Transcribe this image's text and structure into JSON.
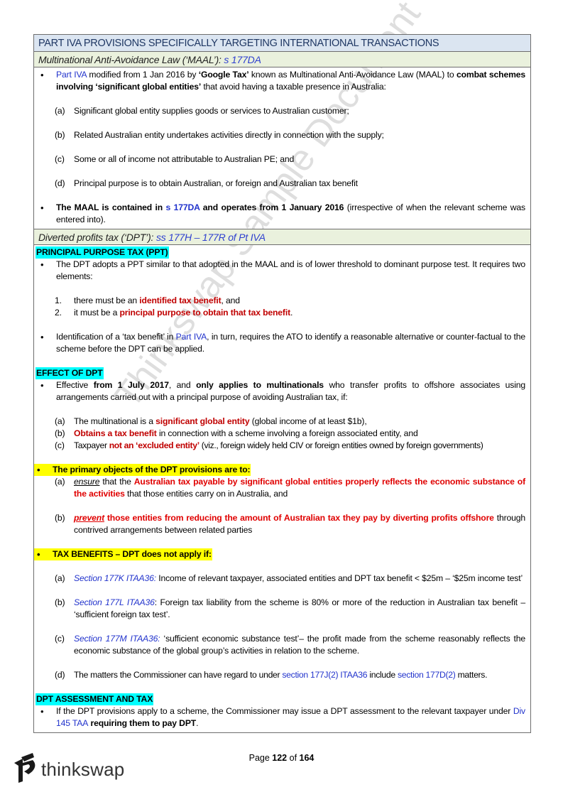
{
  "doc": {
    "title": "PART IVA PROVISIONS SPECIFICALLY TARGETING INTERNATIONAL TRANSACTIONS",
    "maal": {
      "heading_text": "Multinational Anti-Avoidance Law (‘MAAL’): ",
      "heading_ref": "s 177DA",
      "bullet1": {
        "link": "Part IVA",
        "t1": " modified from 1 Jan 2016 by ",
        "b1": "‘Google Tax’",
        "t2": " known as Multinational Anti-Avoidance Law (MAAL) to ",
        "b2": "combat schemes involving ‘significant global entities’",
        "t3": " that avoid having a taxable presence in Australia:"
      },
      "items": [
        {
          "label": "(a)",
          "text": "Significant global entity supplies goods or services to Australian customer;"
        },
        {
          "label": "(b)",
          "text": "Related Australian entity undertakes activities directly in connection with the supply;"
        },
        {
          "label": "(c)",
          "text": "Some or all of income not attributable to Australian PE; and"
        },
        {
          "label": "(d)",
          "text": "Principal purpose is to obtain Australian, or foreign and Australian tax benefit"
        }
      ],
      "bullet2": {
        "b1": "The MAAL is contained in ",
        "link": "s 177DA",
        "b2": " and operates from 1 January 2016",
        "t1": " (irrespective of when the relevant scheme was entered into)."
      }
    },
    "dpt": {
      "heading_text": "Diverted profits tax (‘DPT’): ",
      "heading_ref": "ss 177H – 177R of Pt IVA",
      "ppt": {
        "label": "PRINCIPAL PURPOSE TAX (PPT)",
        "bullet1": "The DPT adopts a PPT similar to that adopted in the MAAL and is of lower threshold to dominant purpose test. It requires two elements:",
        "items": [
          {
            "label": "1.",
            "t1": "there must be an ",
            "red": "identified tax benefit",
            "t2": ", and"
          },
          {
            "label": "2.",
            "t1": "it must be a ",
            "red": "principal purpose to obtain that tax benefit",
            "t2": "."
          }
        ],
        "bullet2": {
          "t1": "Identification of a ‘tax benefit’ in ",
          "link": "Part IVA",
          "t2": ", in turn, requires the ATO to identify a reasonable alternative or counter-factual to the scheme before the DPT can be applied."
        }
      },
      "effect": {
        "label": "EFFECT OF DPT",
        "bullet1": {
          "t1": "Effective ",
          "b1": "from 1 July 2017",
          "t2": ", and ",
          "b2": "only applies to multinationals",
          "t3": " who transfer profits to offshore associates using arrangements carried out with a principal purpose of avoiding Australian tax, if:"
        },
        "items": [
          {
            "label": "(a)",
            "t1": "The multinational is a ",
            "red": "significant global entity",
            "t2": " (global income of at least $1b),"
          },
          {
            "label": "(b)",
            "t1": "",
            "red": "Obtains a tax benefit",
            "t2": " in connection with a scheme involving a foreign associated entity, and"
          },
          {
            "label": "(c)",
            "t1": "Taxpayer ",
            "red": "not an ‘excluded entity’",
            "t2": " (viz., foreign widely held CIV or foreign entities owned by foreign governments)"
          }
        ],
        "objects": {
          "heading": "The primary objects of the DPT provisions are to:",
          "items": [
            {
              "label": "(a)",
              "em": "ensure",
              "t1": " that the ",
              "red": "Australian tax payable by significant global entities properly reflects the economic substance of the activities",
              "t2": " that those entities carry on in Australia, and"
            },
            {
              "label": "(b)",
              "em": "prevent",
              "t1": " ",
              "red": "those entities from reducing the amount of Australian tax they pay by diverting profits offshore",
              "t2": " through contrived arrangements between related parties"
            }
          ]
        },
        "benefits": {
          "heading": "TAX BENEFITS – DPT does not apply if:",
          "items": [
            {
              "label": "(a)",
              "ref": "Section 177K ITAA36:",
              "text": " Income of relevant taxpayer, associated entities and DPT tax benefit < $25m – ‘$25m income test’"
            },
            {
              "label": "(b)",
              "ref": "Section 177L ITAA36",
              "text": ": Foreign tax liability from the scheme is 80% or more of the reduction in Australian tax benefit – ‘sufficient foreign tax test’."
            },
            {
              "label": "(c)",
              "ref": "Section 177M ITAA36:",
              "text": " ‘sufficient economic substance test’– the profit made from the scheme reasonably reflects the economic substance of the global group’s activities in relation to the scheme."
            }
          ],
          "item_d": {
            "label": "(d)",
            "t1": "The matters the Commissioner can have regard to under ",
            "link1": "section 177J(2) ITAA36",
            "t2": " include ",
            "link2": "section 177D(2)",
            "t3": " matters."
          }
        }
      },
      "assessment": {
        "label": "DPT ASSESSMENT AND TAX",
        "t1": "If the DPT provisions apply to a scheme, the Commissioner may issue a DPT assessment to the relevant taxpayer under ",
        "link": "Div 145 TAA",
        "b1": " requiring them to pay DPT",
        "t2": "."
      }
    }
  },
  "footer": {
    "page_prefix": "Page ",
    "page_current": "122",
    "page_of": " of ",
    "page_total": "164",
    "brand": "thinkswap",
    "logo_icon": "thinkswap-logo-icon"
  },
  "watermark": "Thinkswap Sample Document",
  "colors": {
    "title_band": "#dbe5f1",
    "sub_band": "#eaf1dd",
    "link": "#2233cc",
    "emphasis_red": "#c00000",
    "cyan_highlight": "#00ffff",
    "yellow_highlight": "#ffff00"
  }
}
